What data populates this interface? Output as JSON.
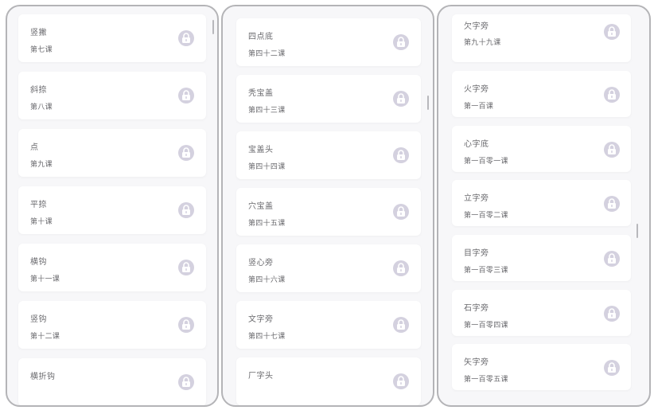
{
  "icon": "lock-icon",
  "colors": {
    "panel_border": "#b4b4b7",
    "panel_bg": "#f7f7f9",
    "card_bg": "#ffffff",
    "lock_bg": "#d4d1df",
    "text": "#6a6a6e"
  },
  "columns": [
    {
      "lessons": [
        {
          "name": "竖撇",
          "number": "第七课"
        },
        {
          "name": "斜捺",
          "number": "第八课"
        },
        {
          "name": "点",
          "number": "第九课"
        },
        {
          "name": "平捺",
          "number": "第十课"
        },
        {
          "name": "横钩",
          "number": "第十一课"
        },
        {
          "name": "竖钩",
          "number": "第十二课"
        },
        {
          "name": "横折钩",
          "number": ""
        }
      ]
    },
    {
      "lessons": [
        {
          "name": "四点底",
          "number": "第四十二课"
        },
        {
          "name": "秃宝盖",
          "number": "第四十三课"
        },
        {
          "name": "宝盖头",
          "number": "第四十四课"
        },
        {
          "name": "穴宝盖",
          "number": "第四十五课"
        },
        {
          "name": "竖心旁",
          "number": "第四十六课"
        },
        {
          "name": "文字旁",
          "number": "第四十七课"
        },
        {
          "name": "厂字头",
          "number": ""
        }
      ]
    },
    {
      "lessons": [
        {
          "name": "欠字旁",
          "number": "第九十九课"
        },
        {
          "name": "火字旁",
          "number": "第一百课"
        },
        {
          "name": "心字底",
          "number": "第一百零一课"
        },
        {
          "name": "立字旁",
          "number": "第一百零二课"
        },
        {
          "name": "目字旁",
          "number": "第一百零三课"
        },
        {
          "name": "石字旁",
          "number": "第一百零四课"
        },
        {
          "name": "矢字旁",
          "number": "第一百零五课"
        }
      ]
    }
  ]
}
